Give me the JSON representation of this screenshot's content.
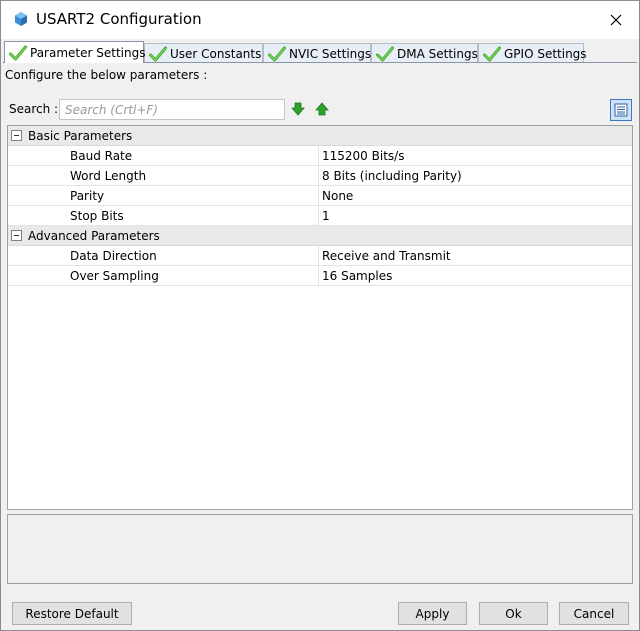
{
  "window": {
    "title": "USART2 Configuration",
    "close_icon": "close-icon",
    "app_icon": "cube-icon"
  },
  "tabs": [
    {
      "label": "Parameter Settings",
      "active": true,
      "icon": "check-icon"
    },
    {
      "label": "User Constants",
      "active": false,
      "icon": "check-icon"
    },
    {
      "label": "NVIC Settings",
      "active": false,
      "icon": "check-icon"
    },
    {
      "label": "DMA Settings",
      "active": false,
      "icon": "check-icon"
    },
    {
      "label": "GPIO Settings",
      "active": false,
      "icon": "check-icon"
    }
  ],
  "panel": {
    "configure_text": "Configure the below parameters :",
    "search_label": "Search :",
    "search_placeholder": "Search (Crtl+F)",
    "search_value": ""
  },
  "parameters": {
    "groups": [
      {
        "label": "Basic Parameters",
        "expanded": true,
        "rows": [
          {
            "name": "Baud Rate",
            "value": "115200 Bits/s"
          },
          {
            "name": "Word Length",
            "value": "8 Bits (including Parity)"
          },
          {
            "name": "Parity",
            "value": "None"
          },
          {
            "name": "Stop Bits",
            "value": "1"
          }
        ]
      },
      {
        "label": "Advanced Parameters",
        "expanded": true,
        "rows": [
          {
            "name": "Data Direction",
            "value": "Receive and Transmit"
          },
          {
            "name": "Over Sampling",
            "value": "16 Samples"
          }
        ]
      }
    ]
  },
  "buttons": {
    "restore_default": "Restore Default",
    "apply": "Apply",
    "ok": "Ok",
    "cancel": "Cancel"
  },
  "colors": {
    "check_green": "#3fae2a",
    "arrow_green": "#2fa12a",
    "active_tab_border": "#8a95a5",
    "group_row_bg": "#e9e9e9",
    "view_button_blue": "#3a78c8"
  }
}
